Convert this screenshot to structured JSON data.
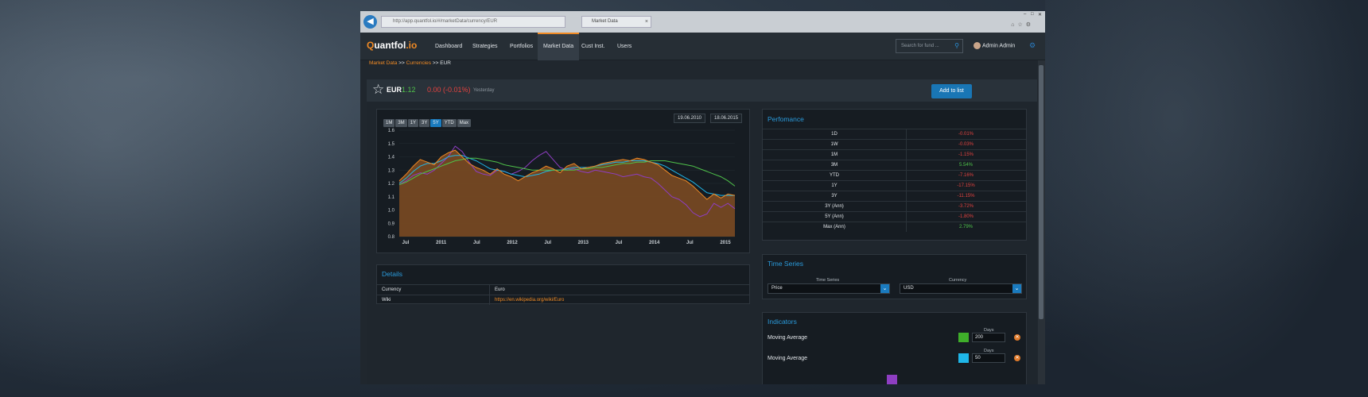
{
  "browser": {
    "url": "http://app.quantfol.io/#/marketData/currency/EUR",
    "tab_title": "Market Data",
    "tab_close": "×",
    "back_icon": "arrow-left-icon"
  },
  "nav": {
    "logo": "Quantfol.io",
    "items": [
      "Dashboard",
      "Strategies",
      "Portfolios",
      "Market Data",
      "Cust Inst.",
      "Users"
    ],
    "active": "Market Data",
    "search_placeholder": "Search for fund ...",
    "user_name": "Admin Admin"
  },
  "breadcrumb": {
    "items": [
      "Market Data",
      "Currencies",
      "EUR"
    ],
    "separator": ">>"
  },
  "symbol": {
    "name": "EUR",
    "price": "1.12",
    "change": "0.00 (-0.01%)",
    "when": "Yesterday",
    "add_button": "Add to list"
  },
  "chart_controls": {
    "ranges": [
      "1M",
      "3M",
      "1Y",
      "3Y",
      "5Y",
      "YTD",
      "Max"
    ],
    "active_range": "5Y",
    "date_from": "19.06.2010",
    "date_to": "18.06.2015"
  },
  "chart_data": {
    "type": "area",
    "x_ticks": [
      "Jul",
      "2011",
      "Jul",
      "2012",
      "Jul",
      "2013",
      "Jul",
      "2014",
      "Jul",
      "2015"
    ],
    "ylim": [
      0.8,
      1.6
    ],
    "y_ticks": [
      "1.6",
      "1.5",
      "1.4",
      "1.3",
      "1.2",
      "1.1",
      "1.0",
      "0.9",
      "0.8"
    ],
    "series": [
      {
        "values": [
          1.22,
          1.27,
          1.33,
          1.38,
          1.36,
          1.34,
          1.4,
          1.43,
          1.45,
          1.4,
          1.35,
          1.32,
          1.3,
          1.27,
          1.31,
          1.27,
          1.25,
          1.22,
          1.25,
          1.28,
          1.3,
          1.33,
          1.31,
          1.28,
          1.33,
          1.35,
          1.31,
          1.32,
          1.33,
          1.35,
          1.36,
          1.37,
          1.38,
          1.37,
          1.39,
          1.38,
          1.36,
          1.34,
          1.3,
          1.26,
          1.24,
          1.22,
          1.18,
          1.13,
          1.08,
          1.12,
          1.09,
          1.12,
          1.11
        ],
        "color": "#f08a24"
      },
      {
        "values": [
          1.2,
          1.24,
          1.29,
          1.33,
          1.35,
          1.35,
          1.37,
          1.4,
          1.41,
          1.41,
          1.39,
          1.37,
          1.34,
          1.31,
          1.3,
          1.29,
          1.27,
          1.26,
          1.25,
          1.26,
          1.27,
          1.29,
          1.3,
          1.3,
          1.31,
          1.32,
          1.32,
          1.32,
          1.33,
          1.34,
          1.35,
          1.36,
          1.36,
          1.37,
          1.37,
          1.37,
          1.36,
          1.35,
          1.33,
          1.3,
          1.27,
          1.24,
          1.21,
          1.17,
          1.13,
          1.12,
          1.11,
          1.11,
          1.11
        ],
        "color": "#1fb6e8"
      },
      {
        "values": [
          1.19,
          1.21,
          1.24,
          1.27,
          1.29,
          1.31,
          1.33,
          1.35,
          1.37,
          1.38,
          1.39,
          1.39,
          1.38,
          1.37,
          1.36,
          1.34,
          1.33,
          1.32,
          1.31,
          1.3,
          1.3,
          1.3,
          1.3,
          1.3,
          1.3,
          1.3,
          1.31,
          1.31,
          1.32,
          1.32,
          1.33,
          1.34,
          1.35,
          1.35,
          1.36,
          1.36,
          1.37,
          1.37,
          1.37,
          1.36,
          1.35,
          1.34,
          1.33,
          1.31,
          1.29,
          1.27,
          1.25,
          1.22,
          1.18
        ],
        "color": "#4fc24a"
      },
      {
        "values": [
          1.19,
          1.22,
          1.26,
          1.28,
          1.27,
          1.3,
          1.35,
          1.4,
          1.48,
          1.44,
          1.36,
          1.29,
          1.27,
          1.26,
          1.3,
          1.29,
          1.27,
          1.29,
          1.32,
          1.37,
          1.41,
          1.44,
          1.38,
          1.32,
          1.3,
          1.31,
          1.29,
          1.28,
          1.3,
          1.29,
          1.28,
          1.27,
          1.25,
          1.26,
          1.27,
          1.25,
          1.24,
          1.2,
          1.15,
          1.1,
          1.08,
          1.04,
          0.98,
          0.95,
          0.97,
          1.05,
          1.02,
          1.05,
          1.01
        ],
        "color": "#8e3ec2"
      }
    ]
  },
  "details": {
    "title": "Details",
    "rows": [
      {
        "label": "Currency",
        "value": "Euro"
      },
      {
        "label": "Wiki",
        "value": "https://en.wikipedia.org/wiki/Euro"
      }
    ]
  },
  "performance": {
    "title": "Perfomance",
    "rows": [
      {
        "label": "1D",
        "value": "-0.01%",
        "color": "#e2423f"
      },
      {
        "label": "1W",
        "value": "-0.03%",
        "color": "#e2423f"
      },
      {
        "label": "1M",
        "value": "-1.15%",
        "color": "#e2423f"
      },
      {
        "label": "3M",
        "value": "5.54%",
        "color": "#4fc24a"
      },
      {
        "label": "YTD",
        "value": "-7.16%",
        "color": "#e2423f"
      },
      {
        "label": "1Y",
        "value": "-17.15%",
        "color": "#e2423f"
      },
      {
        "label": "3Y",
        "value": "-11.15%",
        "color": "#e2423f"
      },
      {
        "label": "3Y (Ann)",
        "value": "-3.72%",
        "color": "#e2423f"
      },
      {
        "label": "5Y (Ann)",
        "value": "-1.80%",
        "color": "#e2423f"
      },
      {
        "label": "Max (Ann)",
        "value": "2.79%",
        "color": "#4fc24a"
      }
    ]
  },
  "time_series": {
    "title": "Time Series",
    "series_label": "Time Series",
    "series_value": "Price",
    "currency_label": "Currency",
    "currency_value": "USD"
  },
  "indicators": {
    "title": "Indicators",
    "days_label": "Days",
    "rows": [
      {
        "name": "Moving Average",
        "color": "#3fae2a",
        "days": "200"
      },
      {
        "name": "Moving Average",
        "color": "#1fb6e8",
        "days": "50"
      }
    ],
    "partial_color": "#8e3ec2"
  }
}
